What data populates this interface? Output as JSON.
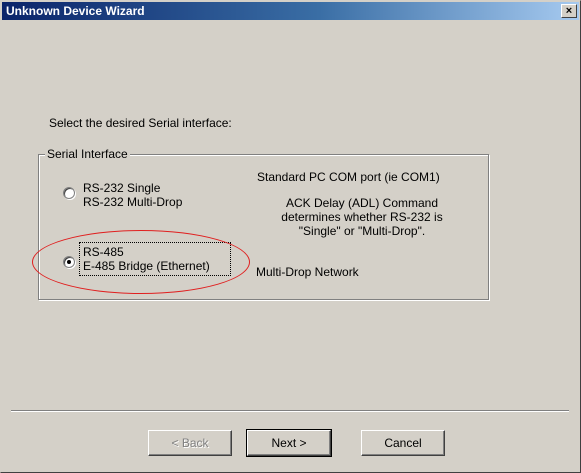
{
  "window": {
    "title": "Unknown Device Wizard",
    "close_glyph": "×"
  },
  "prompt": "Select the desired Serial interface:",
  "group": {
    "label": "Serial Interface",
    "option1": {
      "line1": "RS-232 Single",
      "line2": "RS-232 Multi-Drop",
      "selected": false
    },
    "option2": {
      "line1": "RS-485",
      "line2": "E-485 Bridge (Ethernet)",
      "selected": true
    },
    "desc1": "Standard PC COM port (ie COM1)",
    "desc2": [
      "ACK Delay (ADL) Command",
      "determines whether RS-232 is",
      "\"Single\" or \"Multi-Drop\"."
    ],
    "desc3": "Multi-Drop Network"
  },
  "buttons": {
    "back": "< Back",
    "next": "Next >",
    "cancel": "Cancel"
  },
  "colors": {
    "title_bar_start": "#0a246a",
    "title_bar_end": "#a6caf0",
    "face": "#d4d0c8",
    "annotation": "#e02020"
  }
}
